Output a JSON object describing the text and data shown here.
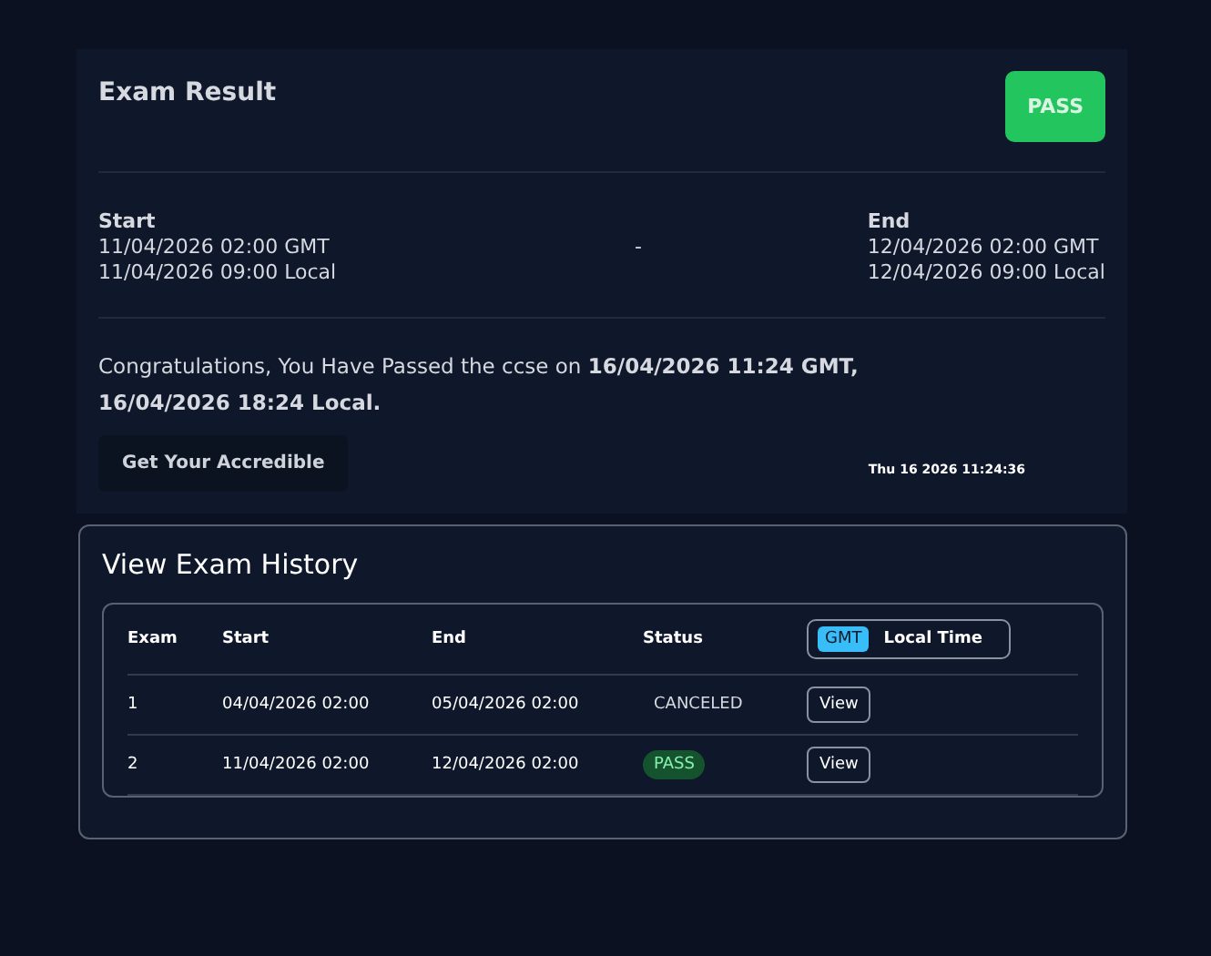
{
  "result": {
    "title": "Exam Result",
    "status_badge": "PASS",
    "start": {
      "label": "Start",
      "gmt": "11/04/2026 02:00 GMT",
      "local": "11/04/2026 09:00 Local"
    },
    "separator": "-",
    "end": {
      "label": "End",
      "gmt": "12/04/2026 02:00 GMT",
      "local": "12/04/2026 09:00 Local"
    },
    "message": "Congratulations, You Have Passed the ccse on **16/04/2026 11:24 GMT, 16/04/2026 18:24 Local.**",
    "button": "Get Your Accredible",
    "timestamp": "Thu 16 2026 11:24:36"
  },
  "history": {
    "title": "View Exam History",
    "columns": [
      "Exam",
      "Start",
      "End",
      "Status"
    ],
    "time_toggle": [
      {
        "label": "GMT",
        "selected": true
      },
      {
        "label": "Local Time",
        "selected": false
      }
    ],
    "rows": [
      {
        "exam": "1",
        "start": "04/04/2026 02:00",
        "end": "05/04/2026 02:00",
        "status": {
          "kind": "plain",
          "text": "CANCELED"
        },
        "action": "View"
      },
      {
        "exam": "2",
        "start": "11/04/2026 02:00",
        "end": "12/04/2026 02:00",
        "status": {
          "kind": "badge",
          "text": "PASS"
        },
        "action": "View"
      }
    ]
  }
}
